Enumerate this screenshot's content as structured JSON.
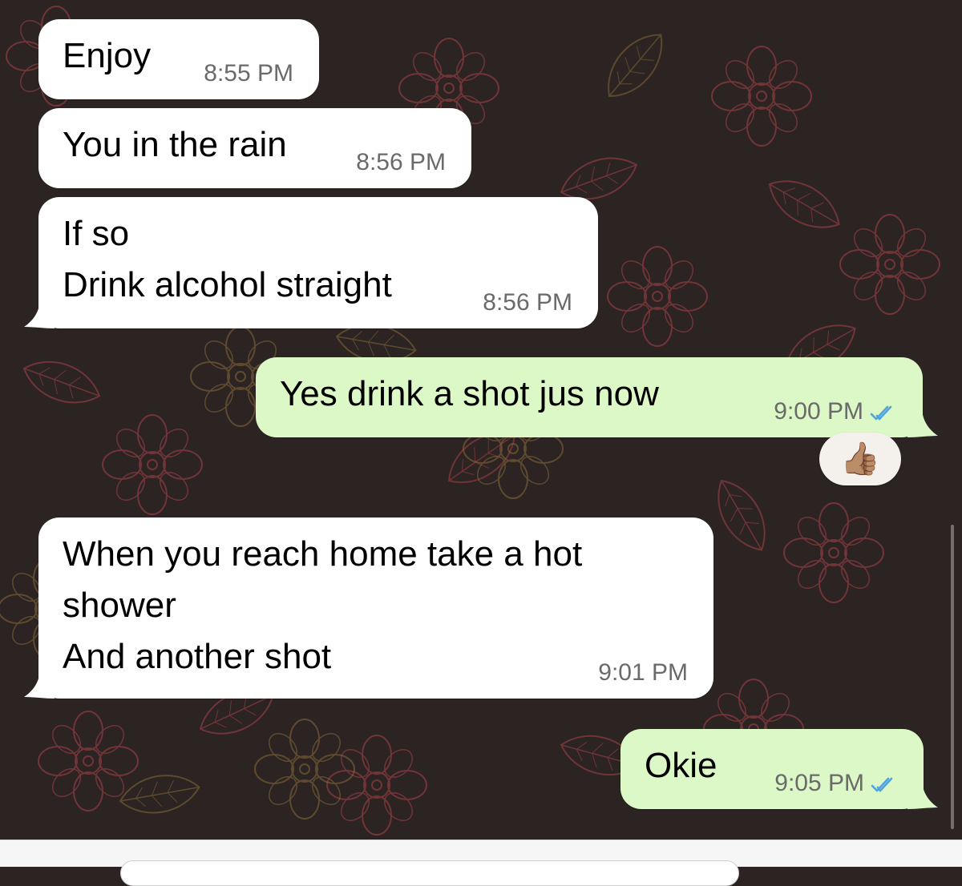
{
  "messages": [
    {
      "direction": "incoming",
      "text": "Enjoy",
      "time": "8:55 PM"
    },
    {
      "direction": "incoming",
      "text": "You in the rain",
      "time": "8:56 PM"
    },
    {
      "direction": "incoming",
      "text": "If so\nDrink alcohol straight",
      "time": "8:56 PM"
    },
    {
      "direction": "outgoing",
      "text": "Yes drink a shot jus now",
      "time": "9:00 PM",
      "status_icon": "read-double-check-icon",
      "reaction": "👍🏽"
    },
    {
      "direction": "incoming",
      "text": "When you reach home take a hot\nshower\nAnd another shot",
      "time": "9:01 PM"
    },
    {
      "direction": "outgoing",
      "text": "Okie",
      "time": "9:05 PM",
      "status_icon": "read-double-check-icon"
    }
  ],
  "colors": {
    "incoming_bubble": "#ffffff",
    "outgoing_bubble": "#dcf8c6",
    "read_tick": "#4fa3e0",
    "wallpaper_base": "#2b2422",
    "wallpaper_pattern": "#8a3a3f"
  }
}
